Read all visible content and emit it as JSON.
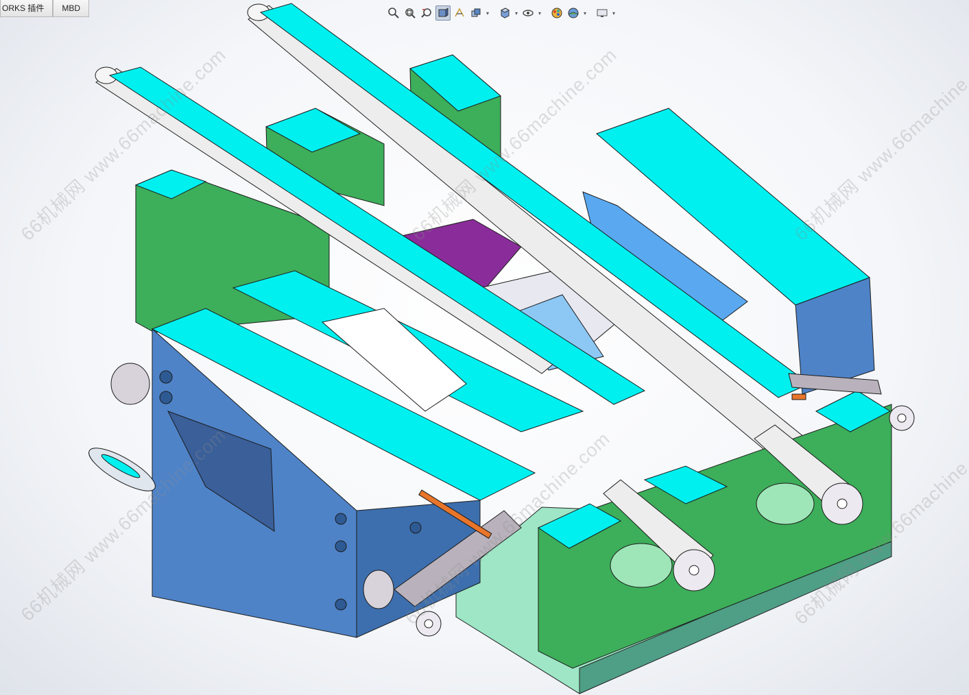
{
  "tabs": [
    {
      "label": "ORKS 插件"
    },
    {
      "label": "MBD"
    }
  ],
  "heads_up_toolbar": [
    {
      "icon": "zoom-to-fit-icon"
    },
    {
      "icon": "zoom-to-area-icon"
    },
    {
      "icon": "previous-view-icon"
    },
    {
      "icon": "section-view-icon",
      "active": true
    },
    {
      "icon": "dynamic-annotation-icon"
    },
    {
      "icon": "view-orientation-icon",
      "dropdown": true
    },
    {
      "icon": "display-style-icon",
      "dropdown": true
    },
    {
      "icon": "hide-show-items-icon",
      "dropdown": true
    },
    {
      "icon": "edit-appearance-icon"
    },
    {
      "icon": "apply-scene-icon",
      "dropdown": true
    },
    {
      "icon": "view-settings-icon",
      "dropdown": true
    }
  ],
  "dropdown_glyph": "▾",
  "watermark": {
    "url_text": "www.66machine.com",
    "cn_text": "66机械网",
    "combined": "66机械网 www.66machine.com",
    "color": "#8c8c8c"
  },
  "model": {
    "description_colors": {
      "cyan": "#00f0f0",
      "green": "#3dae5a",
      "blue": "#4f83c8",
      "purple": "#8a2d9a",
      "orange": "#e8752a",
      "gray": "#b9b2bc"
    }
  }
}
